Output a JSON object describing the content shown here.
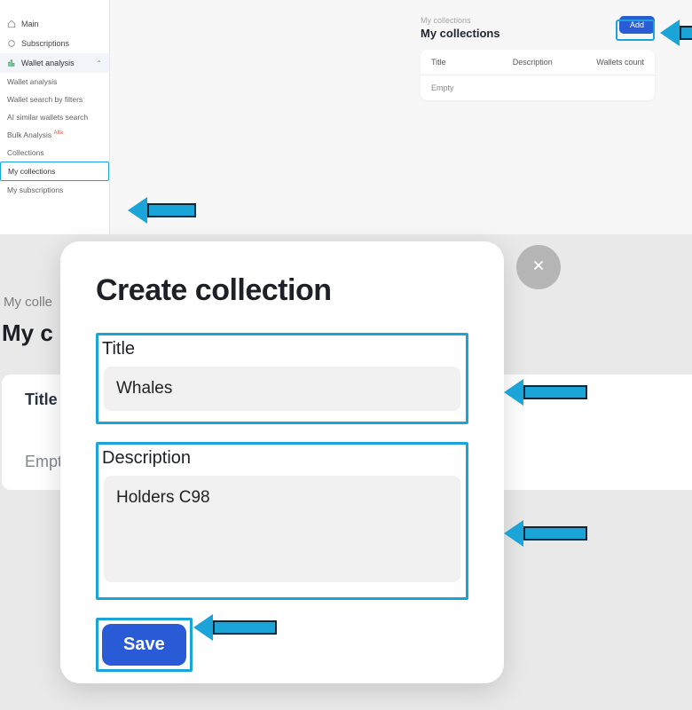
{
  "sidebar": {
    "items": [
      {
        "label": "Main"
      },
      {
        "label": "Subscriptions"
      }
    ],
    "section_label": "Wallet analysis",
    "subitems": [
      {
        "label": "Wallet analysis"
      },
      {
        "label": "Wallet search by filters"
      },
      {
        "label": "AI similar wallets search"
      },
      {
        "label": "Bulk Analysis",
        "tag": "Alfa"
      },
      {
        "label": "Collections"
      },
      {
        "label": "My collections"
      },
      {
        "label": "My subscriptions"
      }
    ]
  },
  "page": {
    "breadcrumb": "My collections",
    "title": "My collections",
    "add_label": "Add",
    "table": {
      "col_title": "Title",
      "col_description": "Description",
      "col_count": "Wallets count",
      "empty": "Empty"
    }
  },
  "bg": {
    "breadcrumb": "My colle",
    "title": "My c",
    "th": "Title",
    "empty": "Empt"
  },
  "modal": {
    "title": "Create collection",
    "title_label": "Title",
    "title_value": "Whales",
    "description_label": "Description",
    "description_value": "Holders C98",
    "save_label": "Save"
  }
}
